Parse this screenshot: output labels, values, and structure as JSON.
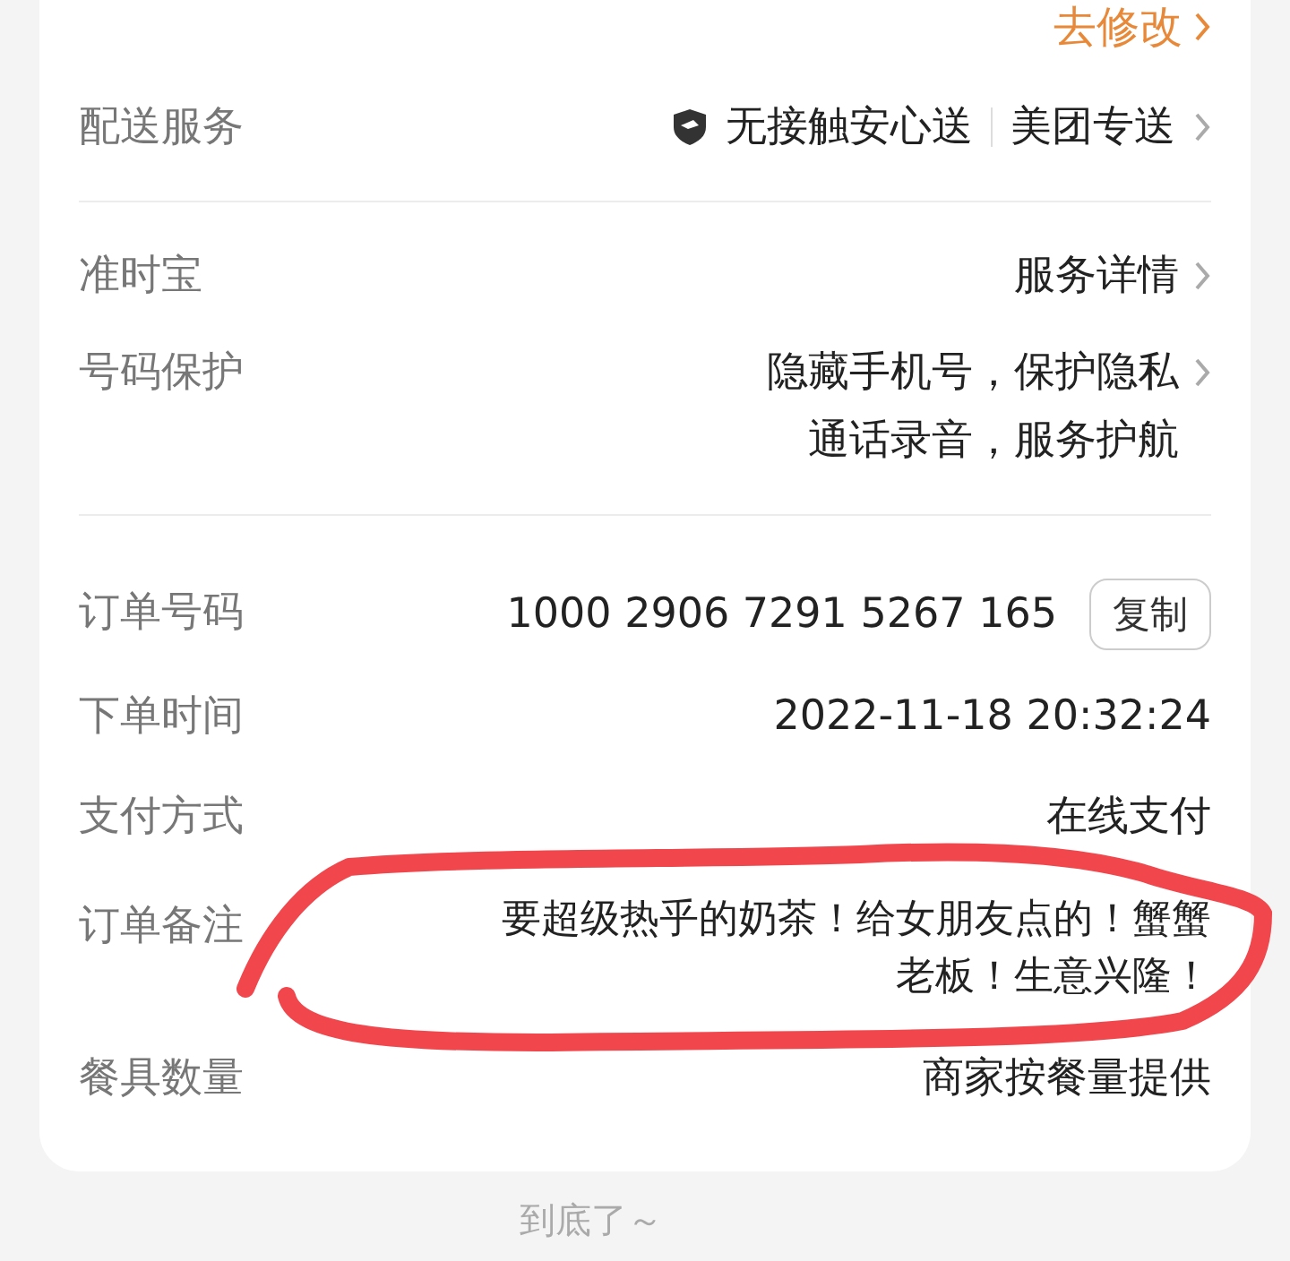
{
  "top_link": {
    "label": "去修改"
  },
  "sections": [
    {
      "rows": [
        {
          "kind": "delivery",
          "label": "配送服务",
          "badge": "无接触安心送",
          "value": "美团专送"
        }
      ]
    },
    {
      "rows": [
        {
          "kind": "link",
          "label": "准时宝",
          "lines": [
            "服务详情"
          ]
        },
        {
          "kind": "link",
          "label": "号码保护",
          "lines": [
            "隐藏手机号，保护隐私",
            "通话录音，服务护航"
          ]
        }
      ]
    },
    {
      "rows": [
        {
          "kind": "copy",
          "label": "订单号码",
          "value": "1000 2906 7291 5267 165",
          "button": "复制"
        },
        {
          "kind": "plain",
          "label": "下单时间",
          "value": "2022-11-18 20:32:24"
        },
        {
          "kind": "plain",
          "label": "支付方式",
          "value": "在线支付"
        },
        {
          "kind": "note",
          "label": "订单备注",
          "value": "要超级热乎的奶茶！给女朋友点的！蟹蟹老板！生意兴隆！"
        },
        {
          "kind": "plain",
          "label": "餐具数量",
          "value": "商家按餐量提供"
        }
      ]
    }
  ],
  "footer": "到底了～"
}
